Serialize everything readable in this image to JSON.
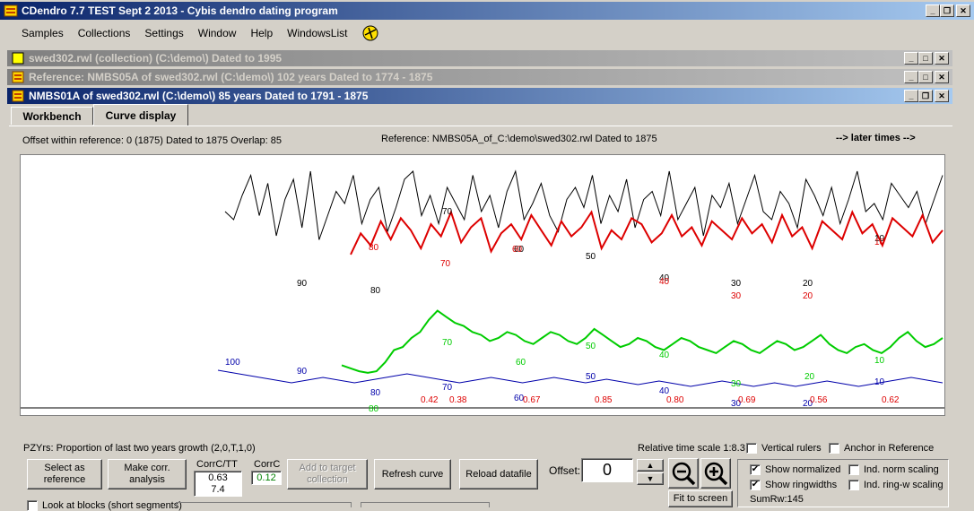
{
  "app": {
    "title": "CDendro 7.7 TEST Sept 2 2013 - Cybis dendro dating program"
  },
  "menu": [
    "Samples",
    "Collections",
    "Settings",
    "Window",
    "Help",
    "WindowsList"
  ],
  "windows": {
    "collection_title": "swed302.rwl (collection)  (C:\\demo\\) Dated to 1995",
    "reference_title": "Reference: NMBS05A of swed302.rwl    (C:\\demo\\)  102 years  Dated to 1774 - 1875",
    "sample_title": "NMBS01A of swed302.rwl    (C:\\demo\\)  85 years  Dated to 1791 - 1875"
  },
  "tabs": {
    "workbench": "Workbench",
    "curve_display": "Curve display"
  },
  "info": {
    "offset_text": "Offset within reference:   0  (1875)   Dated to 1875  Overlap: 85",
    "reference_text": "Reference: NMBS05A_of_C:\\demo\\swed302.rwl  Dated to 1875",
    "later_times": "--> later times -->",
    "pzyrs": "PZYrs: Proportion of last two years growth (2,0,T,1,0)",
    "relative_scale": "Relative time scale 1:8.3"
  },
  "chart_data": {
    "type": "line",
    "series": [
      {
        "color": "#000000",
        "values": [
          52,
          48,
          60,
          70,
          50,
          66,
          40,
          58,
          68,
          44,
          72,
          38,
          50,
          62,
          56,
          70,
          46,
          58,
          64,
          42,
          54,
          68,
          72,
          50,
          60,
          46,
          64,
          56,
          48,
          70,
          52,
          60,
          44,
          62,
          72,
          48,
          56,
          66,
          50,
          42,
          58,
          64,
          54,
          70,
          46,
          60,
          52,
          68,
          44,
          58,
          62,
          50,
          72,
          48,
          56,
          64,
          40,
          60,
          54,
          66,
          46,
          58,
          70,
          52,
          48,
          62,
          56,
          44,
          68,
          60,
          50,
          64,
          46,
          58,
          72,
          52,
          56,
          48,
          66,
          60,
          54,
          62,
          46,
          58,
          70
        ]
      },
      {
        "color": "#dd0000",
        "values": [
          38,
          52,
          44,
          60,
          48,
          62,
          54,
          42,
          58,
          50,
          66,
          46,
          56,
          62,
          40,
          52,
          58,
          48,
          64,
          54,
          44,
          60,
          50,
          56,
          66,
          42,
          54,
          48,
          62,
          58,
          46,
          52,
          64,
          50,
          56,
          44,
          60,
          54,
          48,
          62,
          52,
          58,
          46,
          64,
          50,
          56,
          42,
          60,
          54,
          48,
          66,
          52,
          58,
          44,
          62,
          56,
          50,
          64,
          46,
          54
        ]
      },
      {
        "color": "#00cc00",
        "values": [
          30,
          28,
          26,
          25,
          26,
          32,
          40,
          42,
          48,
          52,
          60,
          66,
          62,
          58,
          56,
          52,
          50,
          46,
          48,
          52,
          50,
          46,
          44,
          48,
          52,
          50,
          46,
          44,
          48,
          54,
          50,
          46,
          42,
          44,
          48,
          46,
          42,
          40,
          44,
          48,
          46,
          42,
          40,
          38,
          42,
          46,
          44,
          40,
          38,
          42,
          46,
          44,
          40,
          42,
          46,
          50,
          44,
          40,
          38,
          42,
          44,
          40,
          38,
          42,
          48,
          52,
          46,
          42,
          44,
          48
        ]
      },
      {
        "color": "#0000aa",
        "values": [
          40,
          38,
          36,
          34,
          32,
          30,
          28,
          26,
          28,
          30,
          32,
          30,
          28,
          26,
          28,
          30,
          32,
          34,
          36,
          34,
          32,
          30,
          28,
          26,
          28,
          30,
          32,
          30,
          28,
          26,
          28,
          30,
          32,
          30,
          28,
          26,
          28,
          30,
          28,
          26,
          24,
          26,
          28,
          26,
          24,
          22,
          24,
          26,
          28,
          26,
          24,
          22,
          24,
          26,
          24,
          22,
          24,
          26,
          28,
          26,
          24,
          22,
          24,
          26,
          28,
          30,
          32,
          30,
          28,
          26
        ]
      }
    ],
    "labels_black": [
      "90",
      "80",
      "70",
      "60",
      "50",
      "40",
      "30",
      "20",
      "10"
    ],
    "labels_red": [
      "80",
      "70",
      "60",
      "40",
      "30",
      "20",
      "10"
    ],
    "labels_green": [
      "80",
      "70",
      "60",
      "50",
      "40",
      "30",
      "20",
      "10"
    ],
    "labels_blue": [
      "100",
      "90",
      "80",
      "70",
      "60",
      "50",
      "40",
      "30",
      "20",
      "10"
    ],
    "labels_corr": [
      "0.42",
      "0.38",
      "0.67",
      "0.85",
      "0.80",
      "0.69",
      "0.56",
      "0.62"
    ]
  },
  "buttons": {
    "select_reference": "Select as reference",
    "make_corr": "Make corr. analysis",
    "add_target": "Add to target collection",
    "refresh_curve": "Refresh curve",
    "reload_datafile": "Reload datafile",
    "fit_screen": "Fit to screen"
  },
  "stats": {
    "corrc_tt_label": "CorrC/TT",
    "corrc_tt_value1": "0.63",
    "corrc_tt_value2": "7.4",
    "corrc_label": "CorrC",
    "corrc_value": "0.12"
  },
  "offset": {
    "label": "Offset:",
    "value": "0"
  },
  "checkboxes": {
    "vertical_rulers": "Vertical rulers",
    "anchor_reference": "Anchor in Reference",
    "show_normalized": "Show normalized",
    "ind_norm": "Ind. norm scaling",
    "show_ringwidths": "Show ringwidths",
    "ind_ring": "Ind. ring-w scaling",
    "look_blocks": "Look at blocks (short segments)"
  },
  "sumrw": "SumRw:145",
  "colors": {
    "titlebar_active": "#0a246a",
    "black_curve": "#000000",
    "red_curve": "#dd0000",
    "green_curve": "#00cc00",
    "blue_curve": "#0000aa"
  }
}
